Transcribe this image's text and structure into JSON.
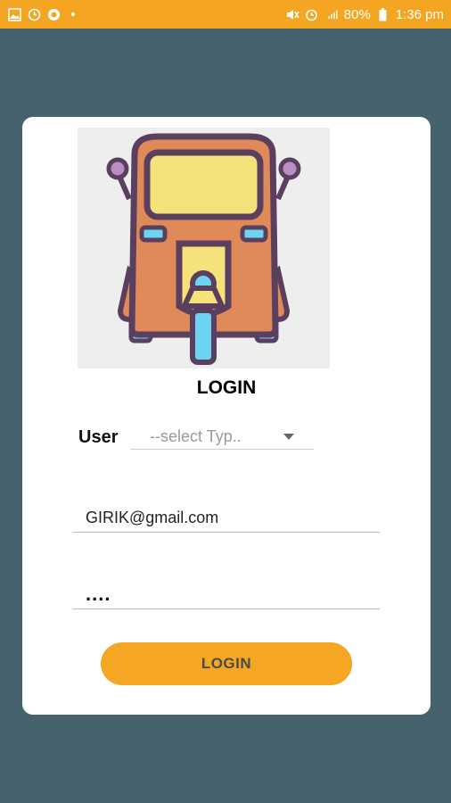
{
  "status_bar": {
    "battery": "80%",
    "time": "1:36 pm"
  },
  "login": {
    "title": "LOGIN",
    "user_label": "User",
    "user_type_placeholder": "--select Typ..",
    "email_value": "GIRIK@gmail.com",
    "password_value": "....",
    "button_label": "LOGIN"
  },
  "colors": {
    "accent": "#f5a623",
    "background": "#46626d",
    "card": "#ffffff"
  }
}
